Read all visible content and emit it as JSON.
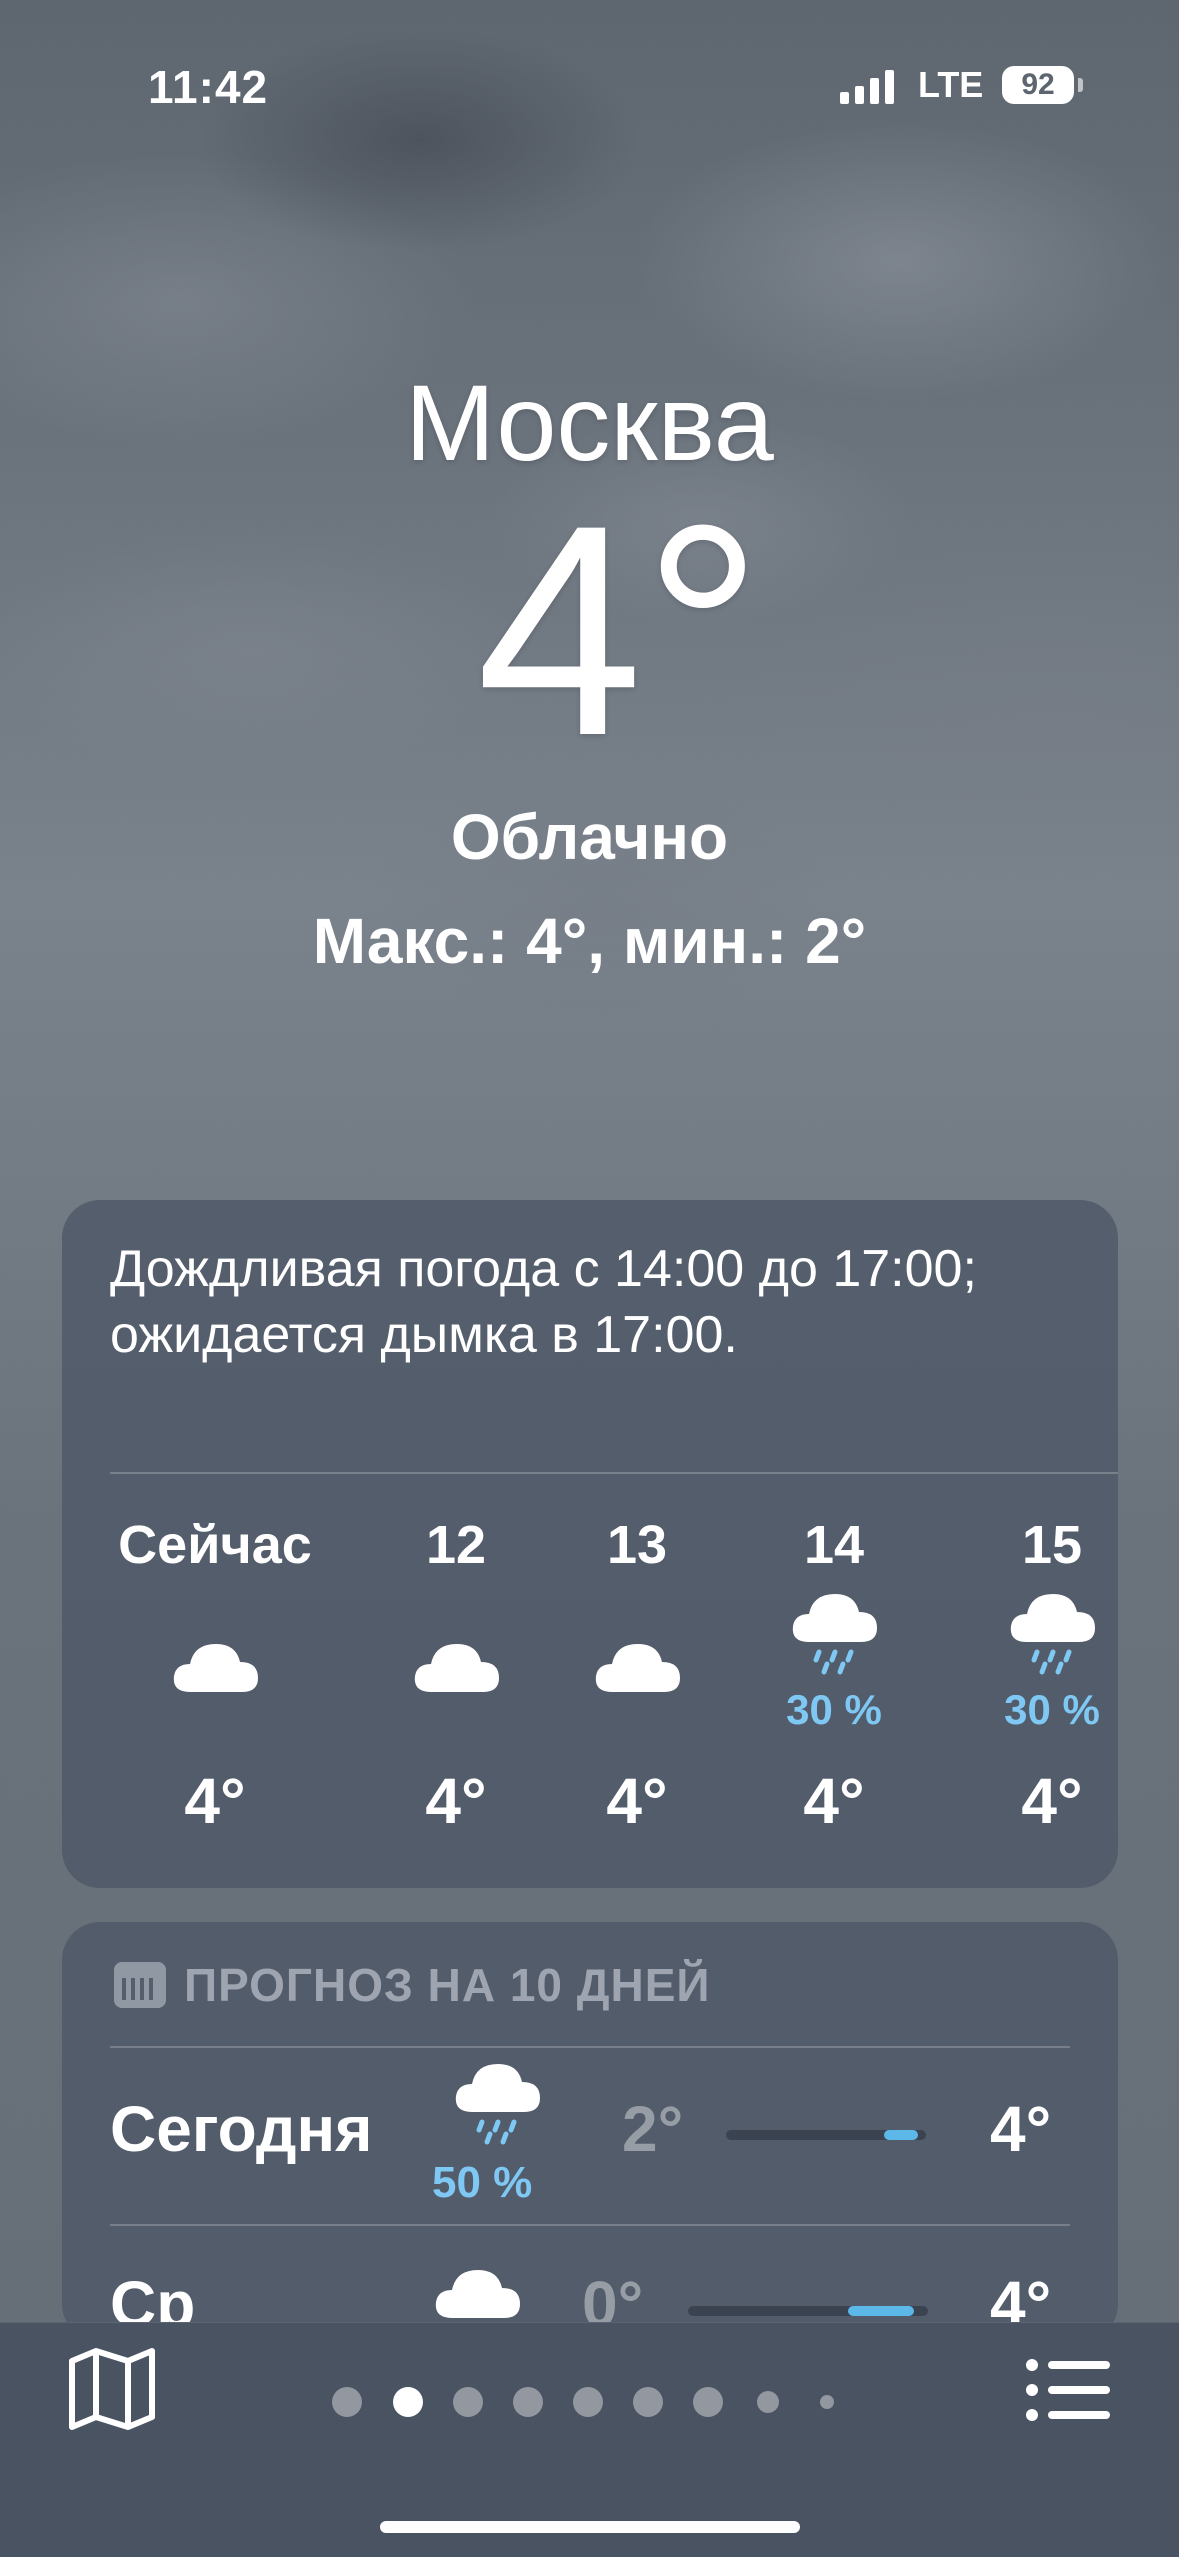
{
  "status_bar": {
    "time": "11:42",
    "network": "LTE",
    "battery": "92"
  },
  "location": {
    "city": "Москва",
    "temperature": "4°",
    "condition": "Облачно",
    "high_low": "Макс.: 4°, мин.: 2°"
  },
  "hourly_card": {
    "summary": "Дождливая погода с 14:00 до 17:00; ожидается дымка в 17:00.",
    "hours": [
      {
        "label": "Сейчас",
        "icon": "cloud-icon",
        "precip": "",
        "temp": "4°"
      },
      {
        "label": "12",
        "icon": "cloud-icon",
        "precip": "",
        "temp": "4°"
      },
      {
        "label": "13",
        "icon": "cloud-icon",
        "precip": "",
        "temp": "4°"
      },
      {
        "label": "14",
        "icon": "cloud-rain-icon",
        "precip": "30 %",
        "temp": "4°"
      },
      {
        "label": "15",
        "icon": "cloud-rain-icon",
        "precip": "30 %",
        "temp": "4°"
      }
    ]
  },
  "daily_card": {
    "header": "ПРОГНОЗ НА 10 ДНЕЙ",
    "days": [
      {
        "day": "Сегодня",
        "icon": "cloud-rain-icon",
        "precip": "50 %",
        "low": "2°",
        "high": "4°"
      },
      {
        "day": "Ср",
        "icon": "cloud-icon",
        "precip": "",
        "low": "0°",
        "high": "4°"
      }
    ]
  },
  "page_indicator": {
    "count": 9,
    "active_index": 1
  },
  "colors": {
    "precip_blue": "#7fc8f4",
    "card_bg": "#4e5866",
    "range_fill": "#5bb8e8"
  }
}
